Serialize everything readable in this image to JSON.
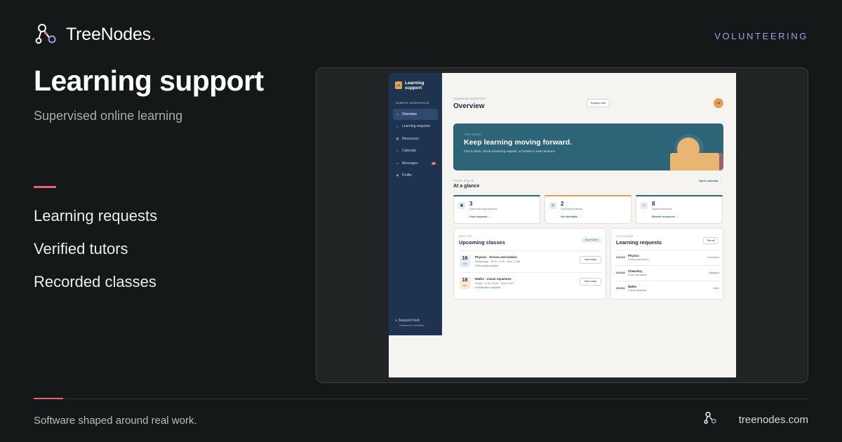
{
  "brand": {
    "name": "TreeNodes",
    "dot": "."
  },
  "tag": "VOLUNTEERING",
  "hero": {
    "title": "Learning support",
    "subtitle": "Supervised online learning"
  },
  "features": [
    "Learning requests",
    "Verified tutors",
    "Recorded classes"
  ],
  "footer": {
    "tagline": "Software shaped around real work.",
    "url": "treenodes.com"
  },
  "colors": {
    "background": "#151819",
    "accent": "#e8636f",
    "tag": "#a99ae9",
    "app_sidebar": "#1e3350",
    "app_hero": "#2d6478"
  },
  "app": {
    "sidebar": {
      "logo": "LS",
      "title": "Learning support",
      "section": "SAMPLE WORKSPACE",
      "items": [
        {
          "label": "Overview",
          "icon": "◇",
          "active": true
        },
        {
          "label": "Learning requests",
          "icon": "≡"
        },
        {
          "label": "Resources",
          "icon": "▦"
        },
        {
          "label": "Calendar",
          "icon": "□"
        },
        {
          "label": "Messages",
          "icon": "▭",
          "badge": "2"
        },
        {
          "label": "Profile",
          "icon": "◉"
        }
      ],
      "footer_title": "Support hub",
      "footer_sub": "Guidance is available"
    },
    "header": {
      "crumb": "LEARNING SUPPORT",
      "title": "Overview",
      "support_button": "Support hub",
      "avatar": "LS"
    },
    "banner": {
      "kicker": "THIS WEEK",
      "title": "Keep learning moving forward.",
      "subtitle": "Find a class, check a learning request, or browse a new resource."
    },
    "glance": {
      "kicker": "YOUR SPACE",
      "title": "At a glance",
      "link": "Open calendar →",
      "stats": [
        {
          "value": "3",
          "label": "Open learning requests",
          "link": "View requests →",
          "icon": "▣"
        },
        {
          "value": "2",
          "label": "Upcoming classes",
          "link": "See timetable →",
          "icon": "◷"
        },
        {
          "value": "8",
          "label": "Saved resources",
          "link": "Browse resources →",
          "icon": "✓"
        }
      ]
    },
    "classes": {
      "kicker": "NEXT UP",
      "title": "Upcoming classes",
      "pill": "Supervised",
      "rows": [
        {
          "day": "16",
          "month": "SEP",
          "title": "Physics · Forces and motion",
          "meta": "Wednesday · 16:00–17:00 · Tutor V-036",
          "status": "● Recording enabled",
          "button": "View class"
        },
        {
          "day": "18",
          "month": "SEP",
          "title": "Maths · Linear equations",
          "meta": "Friday · 17:00–18:00 · Tutor V-021",
          "status": "● Verification complete",
          "button": "View class"
        }
      ]
    },
    "requests": {
      "kicker": "TO REVIEW",
      "title": "Learning requests",
      "button": "See all",
      "rows": [
        {
          "id": "LR-018",
          "subject": "Physics",
          "topic": "Forces and motion",
          "status": "Scheduled"
        },
        {
          "id": "LR-024",
          "subject": "Chemistry",
          "topic": "Acids and alkalis",
          "status": "Assigned"
        },
        {
          "id": "LR-031",
          "subject": "Maths",
          "topic": "Linear equations",
          "status": "Open"
        }
      ]
    }
  }
}
